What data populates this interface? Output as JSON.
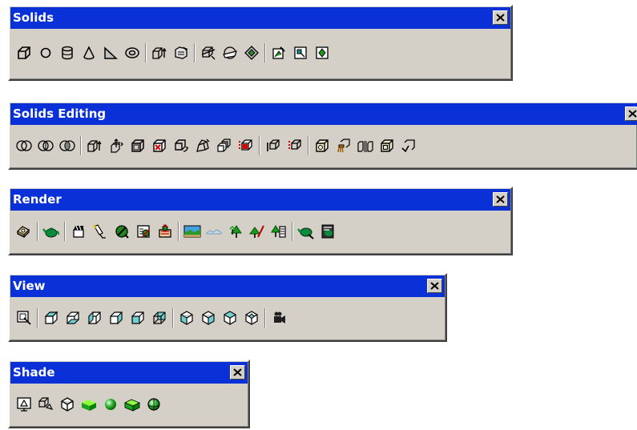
{
  "toolbars": {
    "solids": {
      "title": "Solids",
      "close_glyph": "X",
      "icons": [
        "box-icon",
        "sphere-icon",
        "cylinder-icon",
        "cone-icon",
        "wedge-icon",
        "torus-icon",
        "extrude-icon",
        "revolve-icon",
        "slice-icon",
        "section-icon",
        "interference-icon",
        "setup-drawing-icon",
        "setup-view-icon",
        "setup-profile-icon"
      ]
    },
    "solids_editing": {
      "title": "Solids Editing",
      "close_glyph": "X",
      "icons": [
        "union-icon",
        "subtract-icon",
        "intersect-icon",
        "extrude-faces-icon",
        "move-faces-icon",
        "offset-faces-icon",
        "delete-faces-icon",
        "rotate-faces-icon",
        "taper-faces-icon",
        "copy-faces-icon",
        "color-faces-icon",
        "copy-edges-icon",
        "color-edges-icon",
        "imprint-icon",
        "clean-icon",
        "separate-icon",
        "shell-icon",
        "check-icon"
      ]
    },
    "render": {
      "title": "Render",
      "close_glyph": "X",
      "icons": [
        "hide-icon",
        "render-teapot-icon",
        "scenes-icon",
        "lights-icon",
        "materials-icon",
        "materials-library-icon",
        "mapping-icon",
        "background-icon",
        "fog-icon",
        "new-landscape-icon",
        "edit-landscape-icon",
        "landscape-library-icon",
        "render-preferences-icon",
        "statistics-icon"
      ]
    },
    "view": {
      "title": "View",
      "close_glyph": "X",
      "icons": [
        "named-views-icon",
        "top-view-icon",
        "bottom-view-icon",
        "left-view-icon",
        "right-view-icon",
        "front-view-icon",
        "back-view-icon",
        "sw-isometric-icon",
        "se-isometric-icon",
        "ne-isometric-icon",
        "nw-isometric-icon",
        "camera-icon"
      ]
    },
    "shade": {
      "title": "Shade",
      "close_glyph": "X",
      "icons": [
        "2d-wireframe-icon",
        "3d-wireframe-icon",
        "hidden-icon",
        "flat-shaded-icon",
        "gouraud-shaded-icon",
        "flat-shaded-edges-icon",
        "gouraud-shaded-edges-icon"
      ]
    }
  },
  "colors": {
    "title_bar": "#0a30d8",
    "toolbar_bg": "#d4d0c8"
  }
}
